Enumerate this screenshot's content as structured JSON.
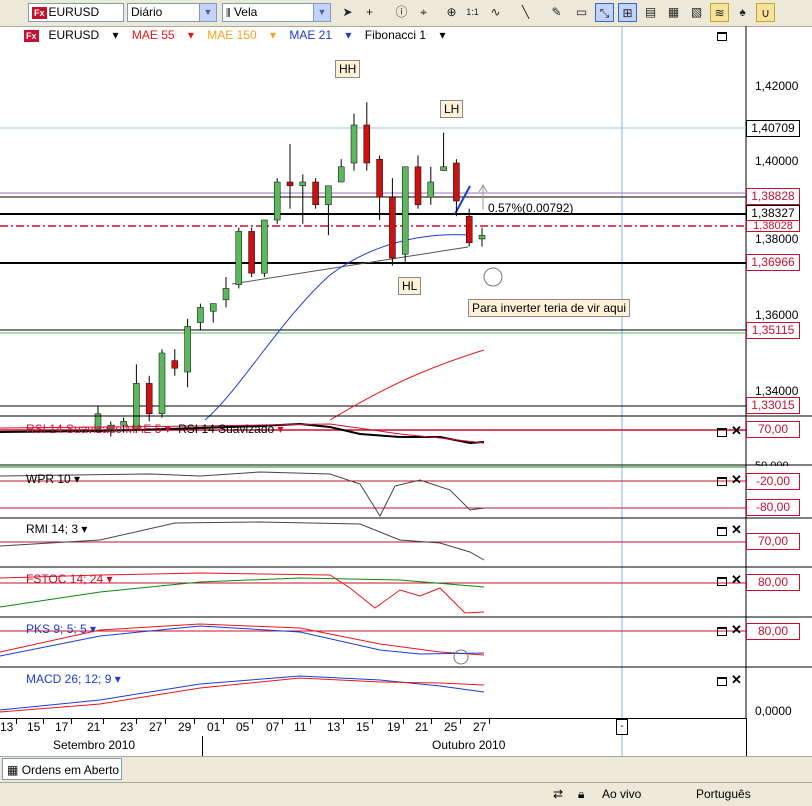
{
  "toolbar": {
    "symbol": "EURUSD",
    "period": "Diário",
    "chart_type": "Vela",
    "tools": [
      "cursor-icon",
      "crosshair-icon",
      "info-icon",
      "draw-icon",
      "zoom-icon",
      "one-to-one-icon",
      "wave-icon",
      "line-icon",
      "pen-icon",
      "eraser-icon",
      "cross-draw-icon",
      "fit-icon",
      "pattern-icon",
      "shapes-icon",
      "magnet-icon",
      "fx-icon",
      "scale-icon",
      "lock-icon"
    ]
  },
  "legend": {
    "symbol": "EURUSD",
    "mae55": "MAE 55",
    "mae150": "MAE 150",
    "mae21": "MAE 21",
    "fib": "Fibonacci 1"
  },
  "colors": {
    "mae55": "#e8161a",
    "mae150": "#f5a623",
    "mae21": "#1c3cd6",
    "candle_up": "#5cb85c",
    "candle_down": "#cc1111"
  },
  "annotations": {
    "hh": "HH",
    "lh": "LH",
    "hl": "HL",
    "pct": "0.57%(0.00792)",
    "note": "Para inverter teria de vir aqui"
  },
  "price_axis": {
    "labels": [
      "1,42000",
      "1,40000",
      "1,38000",
      "1,36000",
      "1,34000"
    ],
    "tags": [
      {
        "text": "1,40709",
        "color": "#000000"
      },
      {
        "text": "1,38828",
        "color": "#c8102e"
      },
      {
        "text": "1,38327",
        "color": "#000000"
      },
      {
        "text": "1,38028",
        "color": "#c8102e"
      },
      {
        "text": "1,36966",
        "color": "#c8102e"
      },
      {
        "text": "1,35115",
        "color": "#c8102e"
      },
      {
        "text": "1,33015",
        "color": "#c8102e"
      }
    ]
  },
  "indicators": [
    {
      "label": "RSI 14 Suavizado MAE 5",
      "label2": "RSI 14 Suavizado",
      "tag": "70,00",
      "tag2": "50,000"
    },
    {
      "label": "WPR 10",
      "tag": "-20,00",
      "tag2": "-80,00"
    },
    {
      "label": "RMI 14; 3",
      "tag": "70,00"
    },
    {
      "label": "FSTOC 14; 24",
      "tag": "80,00"
    },
    {
      "label": "PKS 9; 5; 5",
      "tag": "80,00"
    },
    {
      "label": "MACD 26; 12; 9",
      "tag": "0,0000"
    }
  ],
  "dates": [
    "13",
    "15",
    "17",
    "21",
    "23",
    "27",
    "29",
    "01",
    "05",
    "07",
    "11",
    "13",
    "15",
    "19",
    "21",
    "25",
    "27"
  ],
  "date_marker": "-",
  "months": [
    "Setembro 2010",
    "Outubro 2010"
  ],
  "bottom_tab": "Ordens em Aberto",
  "status": {
    "mode": "Ao vivo",
    "language": "Português"
  },
  "chart_data": {
    "type": "candlestick",
    "series": [
      {
        "o": 1.33,
        "h": 1.336,
        "l": 1.329,
        "c": 1.334,
        "dir": "up"
      },
      {
        "o": 1.33,
        "h": 1.332,
        "l": 1.328,
        "c": 1.331,
        "dir": "up"
      },
      {
        "o": 1.331,
        "h": 1.333,
        "l": 1.329,
        "c": 1.332,
        "dir": "up"
      },
      {
        "o": 1.33,
        "h": 1.347,
        "l": 1.329,
        "c": 1.342,
        "dir": "up"
      },
      {
        "o": 1.342,
        "h": 1.344,
        "l": 1.332,
        "c": 1.334,
        "dir": "down"
      },
      {
        "o": 1.334,
        "h": 1.351,
        "l": 1.333,
        "c": 1.35,
        "dir": "up"
      },
      {
        "o": 1.348,
        "h": 1.351,
        "l": 1.344,
        "c": 1.346,
        "dir": "down"
      },
      {
        "o": 1.345,
        "h": 1.359,
        "l": 1.341,
        "c": 1.357,
        "dir": "up"
      },
      {
        "o": 1.358,
        "h": 1.363,
        "l": 1.356,
        "c": 1.362,
        "dir": "up"
      },
      {
        "o": 1.361,
        "h": 1.363,
        "l": 1.358,
        "c": 1.363,
        "dir": "up"
      },
      {
        "o": 1.364,
        "h": 1.37,
        "l": 1.362,
        "c": 1.367,
        "dir": "up"
      },
      {
        "o": 1.368,
        "h": 1.383,
        "l": 1.367,
        "c": 1.382,
        "dir": "up"
      },
      {
        "o": 1.382,
        "h": 1.383,
        "l": 1.37,
        "c": 1.371,
        "dir": "down"
      },
      {
        "o": 1.371,
        "h": 1.385,
        "l": 1.37,
        "c": 1.385,
        "dir": "up"
      },
      {
        "o": 1.385,
        "h": 1.396,
        "l": 1.384,
        "c": 1.395,
        "dir": "up"
      },
      {
        "o": 1.395,
        "h": 1.405,
        "l": 1.388,
        "c": 1.394,
        "dir": "down"
      },
      {
        "o": 1.394,
        "h": 1.397,
        "l": 1.384,
        "c": 1.395,
        "dir": "up"
      },
      {
        "o": 1.395,
        "h": 1.396,
        "l": 1.388,
        "c": 1.389,
        "dir": "down"
      },
      {
        "o": 1.389,
        "h": 1.394,
        "l": 1.381,
        "c": 1.394,
        "dir": "up"
      },
      {
        "o": 1.395,
        "h": 1.401,
        "l": 1.396,
        "c": 1.399,
        "dir": "up"
      },
      {
        "o": 1.4,
        "h": 1.413,
        "l": 1.398,
        "c": 1.41,
        "dir": "up"
      },
      {
        "o": 1.41,
        "h": 1.416,
        "l": 1.398,
        "c": 1.4,
        "dir": "down"
      },
      {
        "o": 1.401,
        "h": 1.402,
        "l": 1.385,
        "c": 1.391,
        "dir": "down"
      },
      {
        "o": 1.391,
        "h": 1.396,
        "l": 1.373,
        "c": 1.375,
        "dir": "down"
      },
      {
        "o": 1.376,
        "h": 1.399,
        "l": 1.374,
        "c": 1.399,
        "dir": "up"
      },
      {
        "o": 1.399,
        "h": 1.402,
        "l": 1.388,
        "c": 1.389,
        "dir": "down"
      },
      {
        "o": 1.391,
        "h": 1.399,
        "l": 1.389,
        "c": 1.395,
        "dir": "up"
      },
      {
        "o": 1.398,
        "h": 1.408,
        "l": 1.398,
        "c": 1.399,
        "dir": "up"
      },
      {
        "o": 1.4,
        "h": 1.401,
        "l": 1.386,
        "c": 1.39,
        "dir": "down"
      },
      {
        "o": 1.386,
        "h": 1.388,
        "l": 1.378,
        "c": 1.379,
        "dir": "down"
      },
      {
        "o": 1.38,
        "h": 1.383,
        "l": 1.378,
        "c": 1.381,
        "dir": "up"
      }
    ]
  }
}
